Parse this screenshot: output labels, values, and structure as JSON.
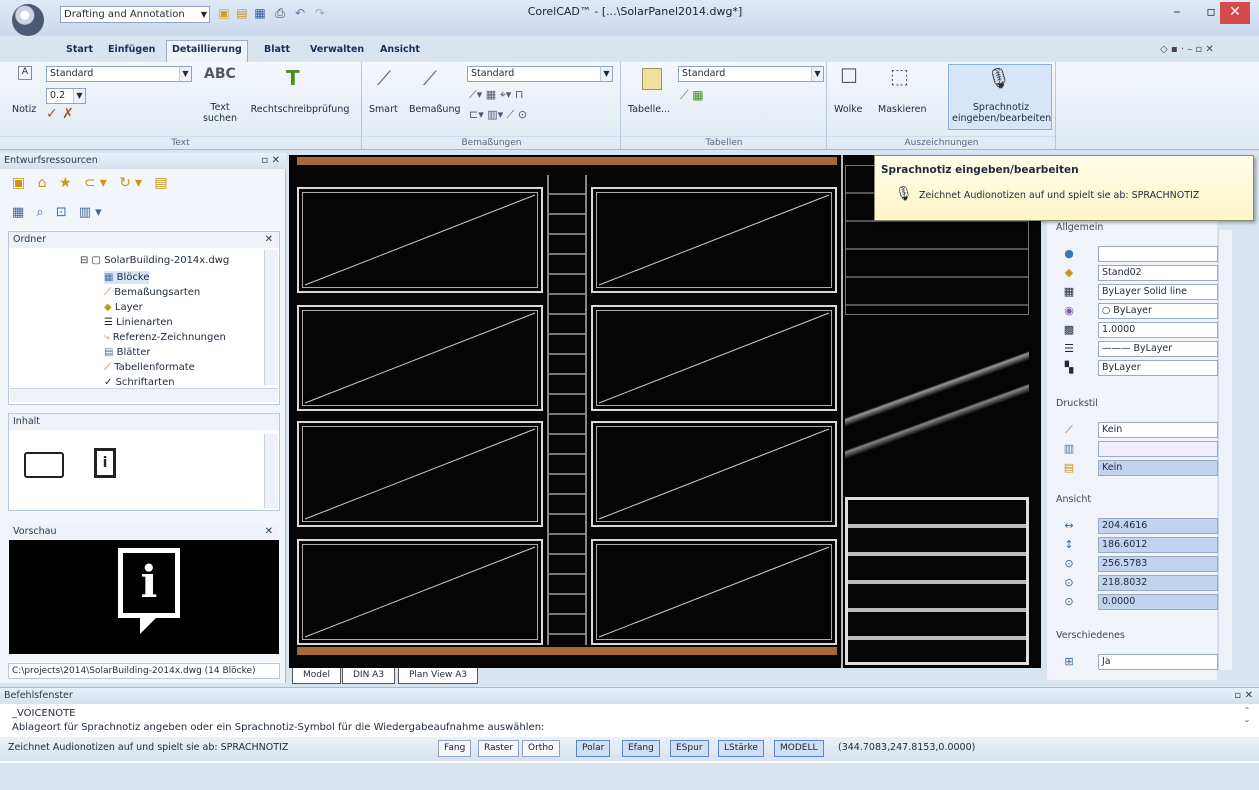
{
  "titlebar": {
    "workspace": "Drafting and Annotation",
    "title": "CorelCAD™ - [...\\SolarPanel2014.dwg*]"
  },
  "tabs": [
    {
      "label": "Start"
    },
    {
      "label": "Einfügen"
    },
    {
      "label": "Detaillierung"
    },
    {
      "label": "Blatt"
    },
    {
      "label": "Verwalten"
    },
    {
      "label": "Ansicht"
    }
  ],
  "ribbon": {
    "text": {
      "style": "Standard",
      "height": "0.2",
      "note_label": "Notiz",
      "find_label": "Text suchen",
      "spell_label": "Rechtschreibprüfung",
      "group": "Text"
    },
    "dims": {
      "smart": "Smart",
      "bemassung": "Bemaßung",
      "style": "Standard",
      "group": "Bemaßungen"
    },
    "tables": {
      "style": "Standard",
      "tabelle": "Tabelle...",
      "group": "Tabellen"
    },
    "markup": {
      "wolke": "Wolke",
      "maskieren": "Maskieren",
      "voicenote": "Sprachnotiz eingeben/bearbeiten",
      "group": "Auszeichnungen"
    }
  },
  "left": {
    "resources_title": "Entwurfsressourcen",
    "folder_title": "Ordner",
    "tree": [
      "SolarBuilding-2014x.dwg",
      "Blöcke",
      "Bemaßungsarten",
      "Layer",
      "Linienarten",
      "Referenz-Zeichnungen",
      "Blätter",
      "Tabellenformate",
      "Schriftarten"
    ],
    "content_title": "Inhalt",
    "preview_title": "Vorschau",
    "path": "C:\\projects\\2014\\SolarBuilding-2014x.dwg (14 Blöcke)"
  },
  "layout_tabs": [
    "Model",
    "DIN A3",
    "Plan View A3"
  ],
  "tooltip": {
    "title": "Sprachnotiz eingeben/bearbeiten",
    "text": "Zeichnet Audionotizen auf und spielt sie ab: SPRACHNOTIZ"
  },
  "props": {
    "allgemein": "Allgemein",
    "general": [
      "",
      "Stand02",
      "ByLayer    Solid line",
      "○ ByLayer",
      "1.0000",
      "——— ByLayer",
      "ByLayer"
    ],
    "druckstil": "Druckstil",
    "print": [
      "Kein",
      "",
      "Kein"
    ],
    "ansicht": "Ansicht",
    "view": [
      "204.4616",
      "186.6012",
      "256.5783",
      "218.8032",
      "0.0000"
    ],
    "verschiedenes": "Verschiedenes",
    "misc": "Ja"
  },
  "command": {
    "title": "Befehlsfenster",
    "line1": "_VOICENOTE",
    "line2": "Ablageort für Sprachnotiz angeben oder ein Sprachnotiz-Symbol für die Wiedergabeaufnahme auswählen:",
    "prompt": ":"
  },
  "status": {
    "message": "Zeichnet Audionotizen auf und spielt sie ab: SPRACHNOTIZ",
    "buttons": [
      "Fang",
      "Raster",
      "Ortho",
      "Polar",
      "Efang",
      "ESpur",
      "LStärke",
      "MODELL"
    ],
    "coords": "(344.7083,247.8153,0.0000)"
  }
}
